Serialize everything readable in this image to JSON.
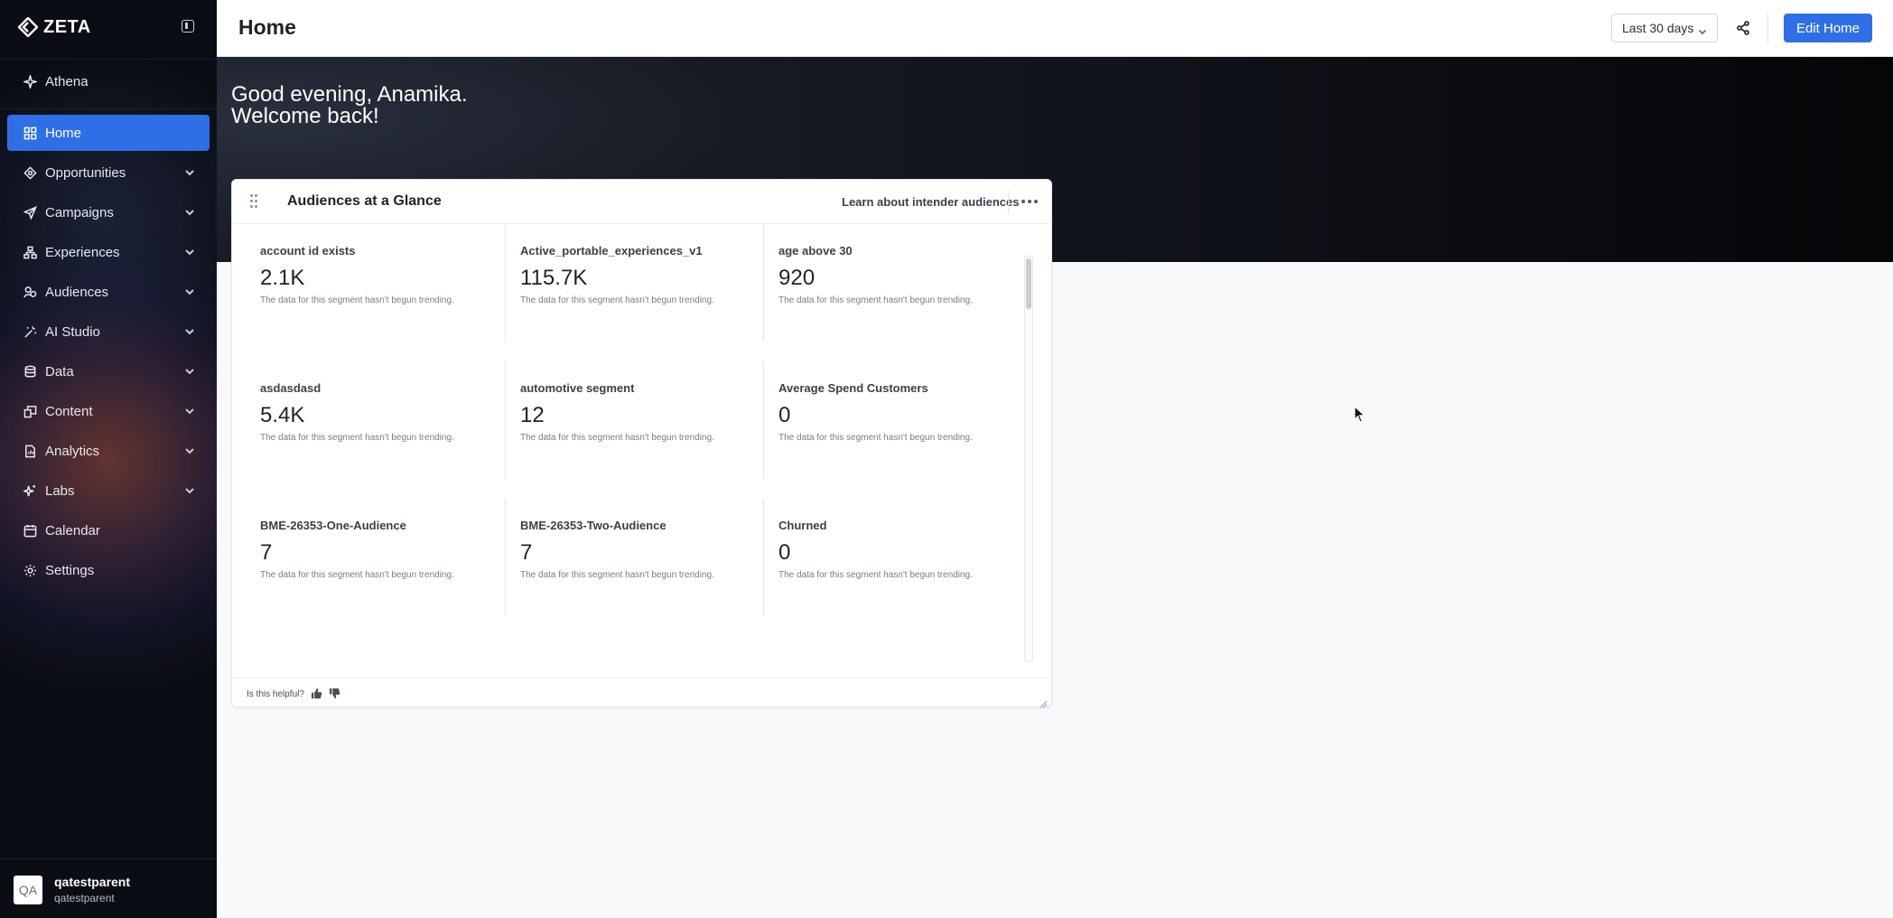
{
  "sidebar": {
    "brand": "ZETA",
    "items": [
      {
        "label": "Athena",
        "icon": "sparkle-icon"
      },
      {
        "label": "Home",
        "icon": "grid-icon",
        "active": true
      },
      {
        "label": "Opportunities",
        "icon": "diamond-icon",
        "expandable": true
      },
      {
        "label": "Campaigns",
        "icon": "send-icon",
        "expandable": true
      },
      {
        "label": "Experiences",
        "icon": "flow-icon",
        "expandable": true
      },
      {
        "label": "Audiences",
        "icon": "people-icon",
        "expandable": true
      },
      {
        "label": "AI Studio",
        "icon": "wand-icon",
        "expandable": true
      },
      {
        "label": "Data",
        "icon": "database-icon",
        "expandable": true
      },
      {
        "label": "Content",
        "icon": "layers-icon",
        "expandable": true
      },
      {
        "label": "Analytics",
        "icon": "report-icon",
        "expandable": true
      },
      {
        "label": "Labs",
        "icon": "sparkle-icon",
        "expandable": true
      },
      {
        "label": "Calendar",
        "icon": "calendar-icon"
      },
      {
        "label": "Settings",
        "icon": "gear-icon"
      }
    ],
    "user": {
      "initials": "QA",
      "name": "qatestparent",
      "sub": "qatestparent"
    }
  },
  "header": {
    "title": "Home",
    "date_range": "Last 30 days",
    "edit_label": "Edit Home"
  },
  "hero": {
    "line1": "Good evening, Anamika.",
    "line2": "Welcome back!"
  },
  "card": {
    "title": "Audiences at a Glance",
    "learn_link": "Learn about intender audiences",
    "helpful": "Is this helpful?",
    "segments": [
      {
        "name": "account id exists",
        "value": "2.1K",
        "note": "The data for this segment hasn't begun trending."
      },
      {
        "name": "Active_portable_experiences_v1",
        "value": "115.7K",
        "note": "The data for this segment hasn't begun trending."
      },
      {
        "name": "age above 30",
        "value": "920",
        "note": "The data for this segment hasn't begun trending."
      },
      {
        "name": "asdasdasd",
        "value": "5.4K",
        "note": "The data for this segment hasn't begun trending."
      },
      {
        "name": "automotive segment",
        "value": "12",
        "note": "The data for this segment hasn't begun trending."
      },
      {
        "name": "Average Spend Customers",
        "value": "0",
        "note": "The data for this segment hasn't begun trending."
      },
      {
        "name": "BME-26353-One-Audience",
        "value": "7",
        "note": "The data for this segment hasn't begun trending."
      },
      {
        "name": "BME-26353-Two-Audience",
        "value": "7",
        "note": "The data for this segment hasn't begun trending."
      },
      {
        "name": "Churned",
        "value": "0",
        "note": "The data for this segment hasn't begun trending."
      }
    ]
  },
  "colors": {
    "accent": "#2f6fe6",
    "sidebar_bg": "#0b0d14"
  }
}
